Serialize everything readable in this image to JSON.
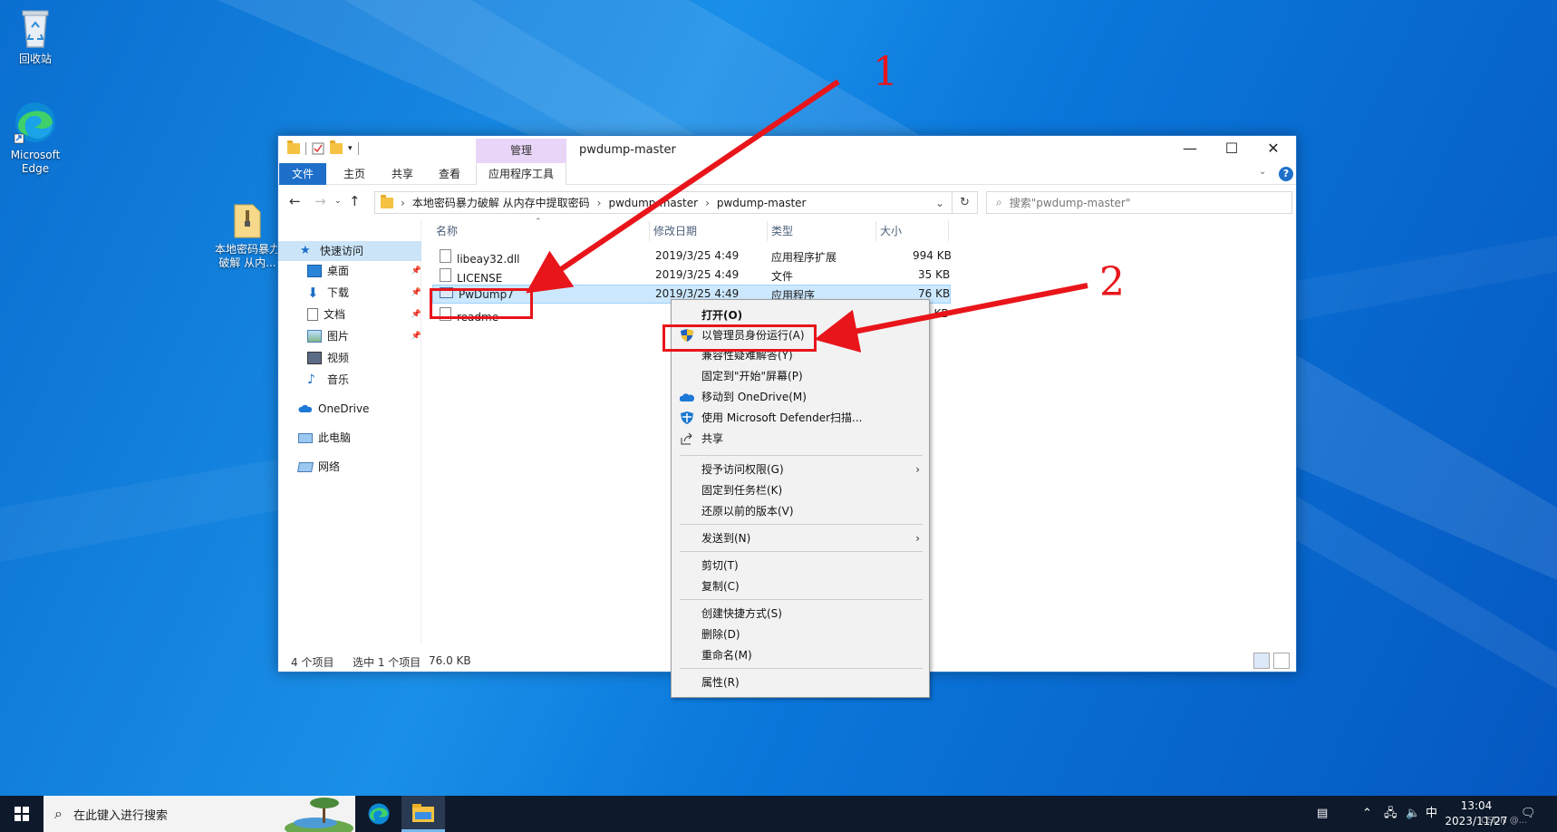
{
  "desktop": {
    "icons": [
      {
        "label": "回收站",
        "icon": "recycle-bin-icon"
      },
      {
        "label": "Microsoft Edge",
        "icon": "edge-icon"
      },
      {
        "label": "本地密码暴力破解 从内...",
        "icon": "zip-folder-icon"
      }
    ]
  },
  "window": {
    "title": "pwdump-master",
    "manage_tab": "管理",
    "ribbon_tabs": [
      "文件",
      "主页",
      "共享",
      "查看",
      "应用程序工具"
    ],
    "address_segments": [
      "本地密码暴力破解 从内存中提取密码",
      "pwdump-master",
      "pwdump-master"
    ],
    "search_placeholder": "搜索\"pwdump-master\"",
    "controls": {
      "minimize": "—",
      "maximize": "☐",
      "close": "✕"
    }
  },
  "nav": {
    "items": [
      {
        "label": "快速访问",
        "icon": "star-icon",
        "pinned": false
      },
      {
        "label": "桌面",
        "icon": "desktop-icon",
        "pinned": true
      },
      {
        "label": "下载",
        "icon": "download-icon",
        "pinned": true
      },
      {
        "label": "文档",
        "icon": "document-icon",
        "pinned": true
      },
      {
        "label": "图片",
        "icon": "picture-icon",
        "pinned": true
      },
      {
        "label": "视频",
        "icon": "video-icon",
        "pinned": false
      },
      {
        "label": "音乐",
        "icon": "music-icon",
        "pinned": false
      },
      {
        "label": "OneDrive",
        "icon": "cloud-icon",
        "pinned": false
      },
      {
        "label": "此电脑",
        "icon": "computer-icon",
        "pinned": false
      },
      {
        "label": "网络",
        "icon": "network-icon",
        "pinned": false
      }
    ]
  },
  "files": {
    "columns": [
      "名称",
      "修改日期",
      "类型",
      "大小"
    ],
    "rows": [
      {
        "name": "libeay32.dll",
        "date": "2019/3/25 4:49",
        "type": "应用程序扩展",
        "size": "994 KB",
        "icon": "dll-file-icon"
      },
      {
        "name": "LICENSE",
        "date": "2019/3/25 4:49",
        "type": "文件",
        "size": "35 KB",
        "icon": "file-icon"
      },
      {
        "name": "PwDump7",
        "date": "2019/3/25 4:49",
        "type": "应用程序",
        "size": "76 KB",
        "icon": "exe-file-icon"
      },
      {
        "name": "readme",
        "date": "",
        "type": "",
        "size": "1 KB",
        "icon": "text-file-icon"
      }
    ]
  },
  "status": {
    "count": "4 个项目",
    "selected": "选中 1 个项目",
    "size": "76.0 KB"
  },
  "context_menu": {
    "items": [
      {
        "label": "打开(O)",
        "bold": true
      },
      {
        "label": "以管理员身份运行(A)",
        "icon": "uac-shield-icon"
      },
      {
        "label": "兼容性疑难解答(Y)"
      },
      {
        "label": "固定到\"开始\"屏幕(P)"
      },
      {
        "label": "移动到 OneDrive(M)",
        "icon": "onedrive-icon"
      },
      {
        "label": "使用 Microsoft Defender扫描...",
        "icon": "defender-icon"
      },
      {
        "label": "共享",
        "icon": "share-icon"
      },
      {
        "label": "授予访问权限(G)",
        "submenu": true
      },
      {
        "label": "固定到任务栏(K)"
      },
      {
        "label": "还原以前的版本(V)"
      },
      {
        "label": "发送到(N)",
        "submenu": true
      },
      {
        "label": "剪切(T)"
      },
      {
        "label": "复制(C)"
      },
      {
        "label": "创建快捷方式(S)"
      },
      {
        "label": "删除(D)"
      },
      {
        "label": "重命名(M)"
      },
      {
        "label": "属性(R)"
      }
    ]
  },
  "annotations": {
    "label1": "1",
    "label2": "2",
    "color": "#e8161a"
  },
  "taskbar": {
    "search_placeholder": "在此键入进行搜索",
    "ime": "中",
    "time": "13:04",
    "date": "2023/11/27",
    "watermark": "CSDN @..."
  }
}
